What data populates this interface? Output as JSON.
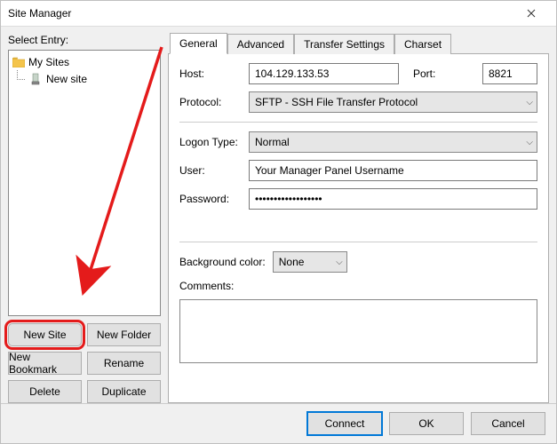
{
  "window": {
    "title": "Site Manager"
  },
  "left": {
    "select_label": "Select Entry:",
    "tree": {
      "root": {
        "label": "My Sites"
      },
      "items": [
        {
          "label": "New site"
        }
      ]
    },
    "buttons": {
      "new_site": "New Site",
      "new_folder": "New Folder",
      "new_bookmark": "New Bookmark",
      "rename": "Rename",
      "delete": "Delete",
      "duplicate": "Duplicate"
    }
  },
  "tabs": {
    "general": "General",
    "advanced": "Advanced",
    "transfer": "Transfer Settings",
    "charset": "Charset"
  },
  "form": {
    "host_label": "Host:",
    "host_value": "104.129.133.53",
    "port_label": "Port:",
    "port_value": "8821",
    "protocol_label": "Protocol:",
    "protocol_value": "SFTP - SSH File Transfer Protocol",
    "logon_type_label": "Logon Type:",
    "logon_type_value": "Normal",
    "user_label": "User:",
    "user_value": "Your Manager Panel Username",
    "password_label": "Password:",
    "password_value": "••••••••••••••••••",
    "bgcolor_label": "Background color:",
    "bgcolor_value": "None",
    "comments_label": "Comments:"
  },
  "footer": {
    "connect": "Connect",
    "ok": "OK",
    "cancel": "Cancel"
  }
}
